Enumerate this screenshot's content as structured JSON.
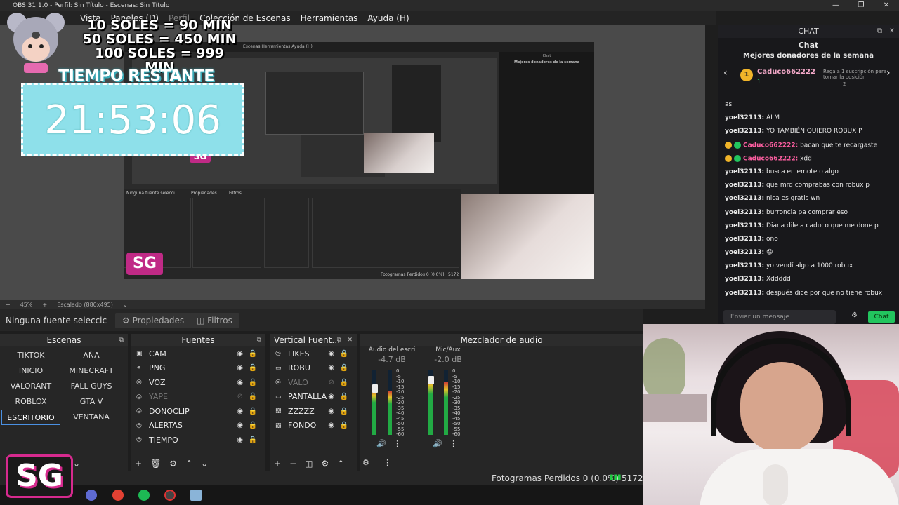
{
  "window": {
    "title": "OBS 31.1.0 - Perfil: Sin Título - Escenas: Sin Título"
  },
  "menu": [
    "Vista",
    "Paneles (D)",
    "Perfil",
    "Colección de Escenas",
    "Herramientas",
    "Ayuda (H)"
  ],
  "overlay": {
    "price1": "10 SOLES = 90 MIN",
    "price2": "50 SOLES = 450 MIN",
    "price3": "100 SOLES = 999 MIN",
    "timer_label": "TIEMPO RESTANTE",
    "timer": "21:53:06"
  },
  "preview": {
    "zoom": "45%",
    "scale": "Escalado (880x495)"
  },
  "source_bar": {
    "none_selected": "Ninguna fuente seleccic",
    "properties": "Propiedades",
    "filters": "Filtros"
  },
  "scenes": {
    "title": "Escenas",
    "items": [
      "TIKTOK",
      "AÑA",
      "INICIO",
      "MINECRAFT",
      "VALORANT",
      "FALL GUYS",
      "ROBLOX",
      "GTA V",
      "ESCRITORIO",
      "VENTANA"
    ],
    "active": "ESCRITORIO"
  },
  "sources": {
    "title": "Fuentes",
    "items": [
      {
        "label": "CAM",
        "icon": "camera-icon"
      },
      {
        "label": "PNG",
        "icon": "link-icon"
      },
      {
        "label": "VOZ",
        "icon": "browser-icon"
      },
      {
        "label": "YAPE",
        "icon": "browser-icon"
      },
      {
        "label": "DONOCLIP",
        "icon": "browser-icon"
      },
      {
        "label": "ALERTAS",
        "icon": "browser-icon"
      },
      {
        "label": "TIEMPO",
        "icon": "browser-icon"
      }
    ]
  },
  "vertical": {
    "title": "Vertical Fuent…",
    "items": [
      {
        "label": "LIKES",
        "icon": "browser-icon"
      },
      {
        "label": "ROBU",
        "icon": "window-icon"
      },
      {
        "label": "VALO",
        "icon": "browser-icon"
      },
      {
        "label": "PANTALLA",
        "icon": "window-icon"
      },
      {
        "label": "ZZZZZ",
        "icon": "image-icon"
      },
      {
        "label": "FONDO",
        "icon": "image-icon"
      }
    ]
  },
  "mixer": {
    "title": "Mezclador de audio",
    "channels": [
      {
        "name": "Audio del escri",
        "db": "-4.7 dB",
        "level": 0.72
      },
      {
        "name": "Mic/Aux",
        "db": "-2.0 dB",
        "level": 0.9
      }
    ],
    "scale": [
      "0",
      "-5",
      "-10",
      "-15",
      "-20",
      "-25",
      "-30",
      "-35",
      "-40",
      "-45",
      "-50",
      "-55",
      "-60"
    ]
  },
  "status": {
    "dropped": "Fotogramas Perdidos 0 (0.0%)",
    "kbps": "5172"
  },
  "chat": {
    "header": "CHAT",
    "tab": "Chat",
    "donors_title": "Mejores donadores de la semana",
    "top_donor": "Caduco662222",
    "top_donor_rank": "1",
    "top_donor_count": "1",
    "gift_text": "Regala 1 suscripción para tomar la posición",
    "gift_count": "2",
    "messages": [
      {
        "user": "",
        "text": "asi"
      },
      {
        "user": "yoel32113:",
        "text": " ALM"
      },
      {
        "user": "yoel32113:",
        "text": " YO TAMBIÉN QUIERO ROBUX P"
      },
      {
        "user": "Caduco662222:",
        "text": " bacan que te recargaste",
        "pink": true
      },
      {
        "user": "Caduco662222:",
        "text": " xdd",
        "pink": true
      },
      {
        "user": "yoel32113:",
        "text": " busca en emote o algo"
      },
      {
        "user": "yoel32113:",
        "text": " que mrd comprabas con robux p"
      },
      {
        "user": "yoel32113:",
        "text": " nica es gratis wn"
      },
      {
        "user": "yoel32113:",
        "text": " burroncia pa comprar eso"
      },
      {
        "user": "yoel32113:",
        "text": " Diana dile a caduco que me done p"
      },
      {
        "user": "yoel32113:",
        "text": " oño"
      },
      {
        "user": "yoel32113:",
        "text": " 😃"
      },
      {
        "user": "yoel32113:",
        "text": " yo vendí algo a 1000 robux"
      },
      {
        "user": "yoel32113:",
        "text": " Xddddd"
      },
      {
        "user": "yoel32113:",
        "text": " después dice por que no tiene robux"
      }
    ],
    "input_placeholder": "Enviar un mensaje",
    "send_label": "Chat"
  },
  "logo": {
    "text": "SG"
  },
  "mini": {
    "menu": "Escenas  Herramientas  Ayuda (H)",
    "none_selected": "Ninguna fuente selecci",
    "properties": "Propiedades",
    "filters": "Filtros",
    "chat": "Chat",
    "donors": "Mejores donadores de la semana",
    "dropped": "Fotogramas Perdidos 0 (0.0%)",
    "kbps": "5172"
  },
  "colors": {
    "accent_pink": "#d62a8e",
    "timer_bg": "#8ee0ea",
    "chat_green": "#22c55e"
  }
}
